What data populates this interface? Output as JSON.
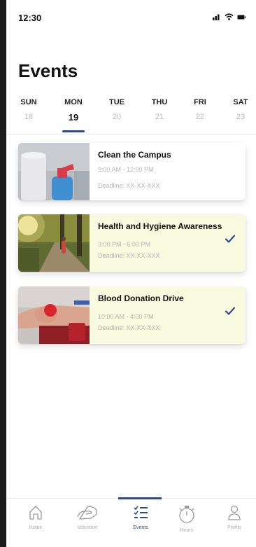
{
  "status": {
    "time": "12:30"
  },
  "page": {
    "title": "Events"
  },
  "week": [
    {
      "name": "SUN",
      "date": "18"
    },
    {
      "name": "MON",
      "date": "19",
      "active": true
    },
    {
      "name": "TUE",
      "date": "20"
    },
    {
      "name": "THU",
      "date": "21"
    },
    {
      "name": "FRI",
      "date": "22"
    },
    {
      "name": "SAT",
      "date": "23"
    }
  ],
  "events": [
    {
      "title": "Clean the Campus",
      "time": "9:00 AM - 12:00 PM",
      "deadline": "Deadline: XX-XX-XXX",
      "registered": false,
      "image": "cleaning-supplies-image"
    },
    {
      "title": "Health and Hygiene Awareness",
      "time": "3:00 PM - 5:00 PM",
      "deadline": "Deadline: XX-XX-XXX",
      "registered": true,
      "image": "forest-path-image"
    },
    {
      "title": "Blood Donation Drive",
      "time": "10:00 AM - 4:00 PM",
      "deadline": "Deadline: XX-XX-XXX",
      "registered": true,
      "image": "blood-donation-image"
    }
  ],
  "tabs": [
    {
      "label": "Home",
      "icon": "home-icon"
    },
    {
      "label": "Volunteer",
      "icon": "volunteer-hands-icon"
    },
    {
      "label": "Events",
      "icon": "events-list-icon",
      "active": true
    },
    {
      "label": "Hours",
      "icon": "stopwatch-icon"
    },
    {
      "label": "Profile",
      "icon": "profile-icon"
    }
  ],
  "colors": {
    "accent": "#2f4a8a",
    "registered_card": "#f8fadf"
  }
}
